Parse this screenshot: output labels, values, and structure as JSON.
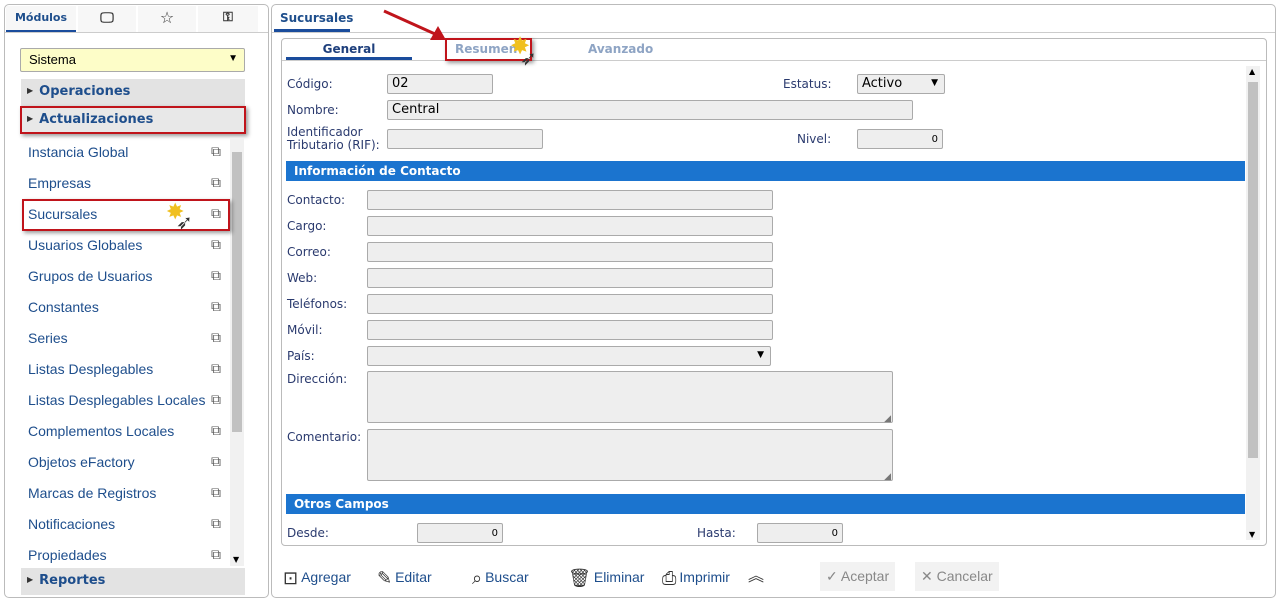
{
  "left": {
    "tabs": [
      "Módulos",
      "monitor-icon",
      "star-icon",
      "key-icon"
    ],
    "module_select": "Sistema",
    "groups": [
      "Operaciones",
      "Actualizaciones",
      "Reportes"
    ],
    "items": [
      "Instancia Global",
      "Empresas",
      "Sucursales",
      "Usuarios Globales",
      "Grupos de Usuarios",
      "Constantes",
      "Series",
      "Listas Desplegables",
      "Listas Desplegables Locales",
      "Complementos Locales",
      "Objetos eFactory",
      "Marcas de Registros",
      "Notificaciones",
      "Propiedades"
    ]
  },
  "main": {
    "tab": "Sucursales",
    "subtabs": [
      "General",
      "Resumen",
      "Avanzado"
    ],
    "codigo": {
      "label": "Código:",
      "value": "02"
    },
    "estatus": {
      "label": "Estatus:",
      "value": "Activo"
    },
    "nombre": {
      "label": "Nombre:",
      "value": "Central"
    },
    "rif": {
      "label1": "Identificador",
      "label2": "Tributario (RIF):",
      "value": ""
    },
    "nivel": {
      "label": "Nivel:",
      "value": "0"
    },
    "section_contact": "Información de Contacto",
    "contact_fields": [
      "Contacto:",
      "Cargo:",
      "Correo:",
      "Web:",
      "Teléfonos:",
      "Móvil:",
      "País:",
      "Dirección:",
      "Comentario:"
    ],
    "section_other": "Otros Campos",
    "desde": {
      "label": "Desde:",
      "value": "0"
    },
    "hasta": {
      "label": "Hasta:",
      "value": "0"
    }
  },
  "toolbar": {
    "agregar": "Agregar",
    "editar": "Editar",
    "buscar": "Buscar",
    "eliminar": "Eliminar",
    "imprimir": "Imprimir",
    "aceptar": "Aceptar",
    "cancelar": "Cancelar"
  },
  "colors": {
    "accent": "#1b74cf",
    "highlight": "#c0141b",
    "link": "#1e4e8c"
  }
}
